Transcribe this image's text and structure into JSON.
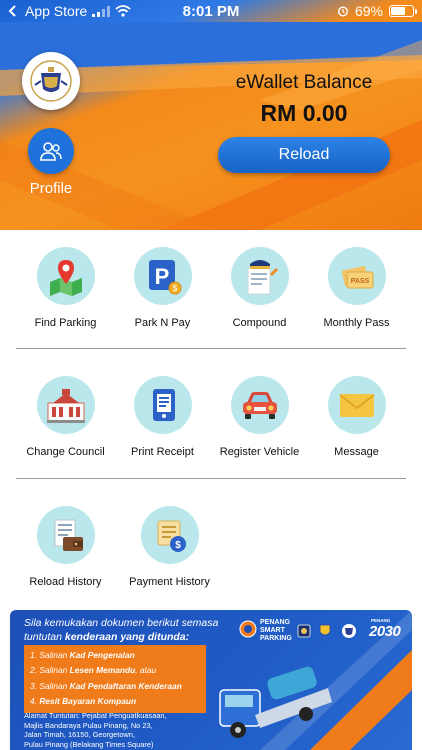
{
  "status_bar": {
    "carrier": "App Store",
    "time": "8:01 PM",
    "battery": "69%",
    "battery_level": 0.69
  },
  "header": {
    "profile_label": "Profile",
    "balance_title": "eWallet Balance",
    "balance_value": "RM 0.00",
    "reload_label": "Reload"
  },
  "menu": {
    "row1": [
      "Find Parking",
      "Park N Pay",
      "Compound",
      "Monthly Pass"
    ],
    "row2": [
      "Change Council",
      "Print Receipt",
      "Register Vehicle",
      "Message"
    ],
    "row3": [
      "Reload History",
      "Payment History"
    ]
  },
  "banner": {
    "heading_line1": "Sila kemukakan dokumen berikut semasa",
    "heading_line2_plain": "tuntutan ",
    "heading_line2_bold": "kenderaan yang ditunda:",
    "items": [
      {
        "num": "1.",
        "pre": "Salinan ",
        "bold": "Kad Pengenalan",
        "post": ""
      },
      {
        "num": "2.",
        "pre": "Salinan ",
        "bold": "Lesen Memandu",
        "post": ", atau"
      },
      {
        "num": "3.",
        "pre": "Salinan ",
        "bold": "Kad Pendaftaran Kenderaan",
        "post": ""
      },
      {
        "num": "4.",
        "pre": "",
        "bold": "Resit Bayaran Kompaun",
        "post": ""
      }
    ],
    "address_label": "Alamat Tuntutan:",
    "address_lines": [
      "Pejabat Penguatkuasaan,",
      "Majlis Bandaraya Pulau Pinang, No 23,",
      "Jalan Timah, 16150, Georgetown,",
      "Pulau Pinang (Belakang Times Square)"
    ],
    "brand_line1": "PENANG",
    "brand_line2": "SMART",
    "brand_line3": "PARKING",
    "penang2030_small": "PENANG",
    "penang2030_big": "2030"
  },
  "colors": {
    "accent_blue": "#1f72db",
    "header_orange": "#f5921e",
    "icon_bg": "#b9e7ec",
    "banner_blue": "#1e4fb8",
    "banner_orange": "#f07b1a"
  }
}
